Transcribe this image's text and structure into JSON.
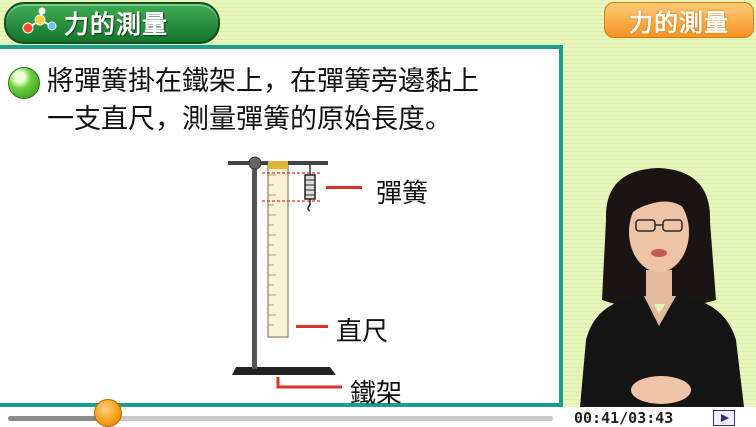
{
  "header": {
    "title": "力的測量",
    "title_icon": "molecule-icon",
    "badge": "力的測量"
  },
  "slide": {
    "bullet_icon": "green-ball-bullet-icon",
    "sentence_line1": "將彈簧掛在鐵架上，在彈簧旁邊黏上",
    "sentence_line2": "一支直尺，測量彈簧的原始長度。",
    "figure": {
      "label_spring": "彈簧",
      "label_ruler": "直尺",
      "label_stand": "鐵架"
    }
  },
  "player": {
    "current_time": "00:41",
    "total_time": "03:43",
    "time_display": "00:41/03:43",
    "progress": 0.184,
    "play_icon": "play-icon"
  },
  "colors": {
    "title_green": "#1f8a38",
    "board_border": "#1e9c8f",
    "badge_orange": "#f5a030",
    "knob_orange": "#f39a15",
    "dashed_red": "#e0302a"
  }
}
